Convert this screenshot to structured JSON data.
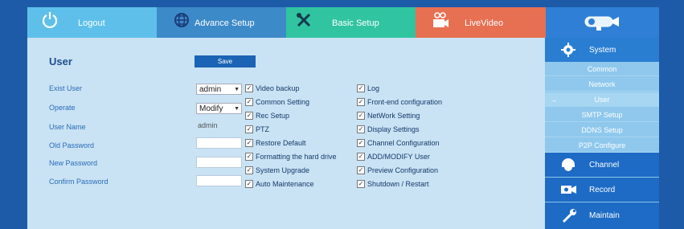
{
  "topnav": {
    "logout": "Logout",
    "advance": "Advance Setup",
    "basic": "Basic Setup",
    "live": "LiveVideo"
  },
  "page": {
    "title": "User",
    "save": "Save"
  },
  "form": {
    "exist_user_label": "Exist User",
    "exist_user_value": "admin",
    "operate_label": "Operate",
    "operate_value": "Modify",
    "user_name_label": "User Name",
    "user_name_value": "admin",
    "old_password_label": "Old Password",
    "new_password_label": "New Password",
    "confirm_password_label": "Confirm Password"
  },
  "permissions_left": [
    "Video backup",
    "Common Setting",
    "Rec Setup",
    "PTZ",
    "Restore Default",
    "Formatting the hard drive",
    "System Upgrade",
    "Auto Maintenance"
  ],
  "permissions_right": [
    "Log",
    "Front-end configuration",
    "NetWork Setting",
    "Display Settings",
    "Channel Configuration",
    "ADD/MODIFY User",
    "Preview Configuration",
    "Shutdown / Restart"
  ],
  "sidebar": {
    "system": "System",
    "items": [
      "Common",
      "Network",
      "User",
      "SMTP Setup",
      "DDNS Setup",
      "P2P Configure"
    ],
    "active_arrow": "→",
    "channel": "Channel",
    "record": "Record",
    "maintain": "Maintain"
  }
}
